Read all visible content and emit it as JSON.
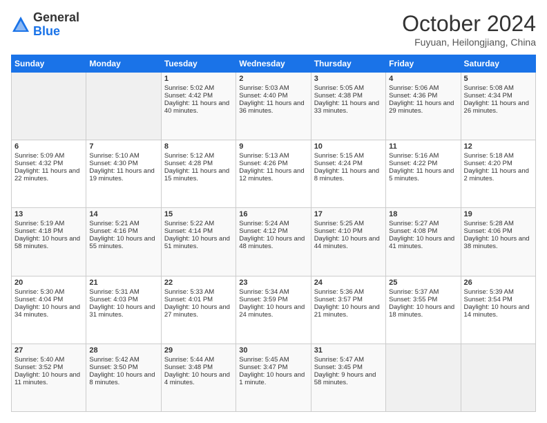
{
  "logo": {
    "general": "General",
    "blue": "Blue"
  },
  "header": {
    "title": "October 2024",
    "subtitle": "Fuyuan, Heilongjiang, China"
  },
  "weekdays": [
    "Sunday",
    "Monday",
    "Tuesday",
    "Wednesday",
    "Thursday",
    "Friday",
    "Saturday"
  ],
  "weeks": [
    [
      {
        "day": "",
        "content": ""
      },
      {
        "day": "",
        "content": ""
      },
      {
        "day": "1",
        "content": "Sunrise: 5:02 AM\nSunset: 4:42 PM\nDaylight: 11 hours and 40 minutes."
      },
      {
        "day": "2",
        "content": "Sunrise: 5:03 AM\nSunset: 4:40 PM\nDaylight: 11 hours and 36 minutes."
      },
      {
        "day": "3",
        "content": "Sunrise: 5:05 AM\nSunset: 4:38 PM\nDaylight: 11 hours and 33 minutes."
      },
      {
        "day": "4",
        "content": "Sunrise: 5:06 AM\nSunset: 4:36 PM\nDaylight: 11 hours and 29 minutes."
      },
      {
        "day": "5",
        "content": "Sunrise: 5:08 AM\nSunset: 4:34 PM\nDaylight: 11 hours and 26 minutes."
      }
    ],
    [
      {
        "day": "6",
        "content": "Sunrise: 5:09 AM\nSunset: 4:32 PM\nDaylight: 11 hours and 22 minutes."
      },
      {
        "day": "7",
        "content": "Sunrise: 5:10 AM\nSunset: 4:30 PM\nDaylight: 11 hours and 19 minutes."
      },
      {
        "day": "8",
        "content": "Sunrise: 5:12 AM\nSunset: 4:28 PM\nDaylight: 11 hours and 15 minutes."
      },
      {
        "day": "9",
        "content": "Sunrise: 5:13 AM\nSunset: 4:26 PM\nDaylight: 11 hours and 12 minutes."
      },
      {
        "day": "10",
        "content": "Sunrise: 5:15 AM\nSunset: 4:24 PM\nDaylight: 11 hours and 8 minutes."
      },
      {
        "day": "11",
        "content": "Sunrise: 5:16 AM\nSunset: 4:22 PM\nDaylight: 11 hours and 5 minutes."
      },
      {
        "day": "12",
        "content": "Sunrise: 5:18 AM\nSunset: 4:20 PM\nDaylight: 11 hours and 2 minutes."
      }
    ],
    [
      {
        "day": "13",
        "content": "Sunrise: 5:19 AM\nSunset: 4:18 PM\nDaylight: 10 hours and 58 minutes."
      },
      {
        "day": "14",
        "content": "Sunrise: 5:21 AM\nSunset: 4:16 PM\nDaylight: 10 hours and 55 minutes."
      },
      {
        "day": "15",
        "content": "Sunrise: 5:22 AM\nSunset: 4:14 PM\nDaylight: 10 hours and 51 minutes."
      },
      {
        "day": "16",
        "content": "Sunrise: 5:24 AM\nSunset: 4:12 PM\nDaylight: 10 hours and 48 minutes."
      },
      {
        "day": "17",
        "content": "Sunrise: 5:25 AM\nSunset: 4:10 PM\nDaylight: 10 hours and 44 minutes."
      },
      {
        "day": "18",
        "content": "Sunrise: 5:27 AM\nSunset: 4:08 PM\nDaylight: 10 hours and 41 minutes."
      },
      {
        "day": "19",
        "content": "Sunrise: 5:28 AM\nSunset: 4:06 PM\nDaylight: 10 hours and 38 minutes."
      }
    ],
    [
      {
        "day": "20",
        "content": "Sunrise: 5:30 AM\nSunset: 4:04 PM\nDaylight: 10 hours and 34 minutes."
      },
      {
        "day": "21",
        "content": "Sunrise: 5:31 AM\nSunset: 4:03 PM\nDaylight: 10 hours and 31 minutes."
      },
      {
        "day": "22",
        "content": "Sunrise: 5:33 AM\nSunset: 4:01 PM\nDaylight: 10 hours and 27 minutes."
      },
      {
        "day": "23",
        "content": "Sunrise: 5:34 AM\nSunset: 3:59 PM\nDaylight: 10 hours and 24 minutes."
      },
      {
        "day": "24",
        "content": "Sunrise: 5:36 AM\nSunset: 3:57 PM\nDaylight: 10 hours and 21 minutes."
      },
      {
        "day": "25",
        "content": "Sunrise: 5:37 AM\nSunset: 3:55 PM\nDaylight: 10 hours and 18 minutes."
      },
      {
        "day": "26",
        "content": "Sunrise: 5:39 AM\nSunset: 3:54 PM\nDaylight: 10 hours and 14 minutes."
      }
    ],
    [
      {
        "day": "27",
        "content": "Sunrise: 5:40 AM\nSunset: 3:52 PM\nDaylight: 10 hours and 11 minutes."
      },
      {
        "day": "28",
        "content": "Sunrise: 5:42 AM\nSunset: 3:50 PM\nDaylight: 10 hours and 8 minutes."
      },
      {
        "day": "29",
        "content": "Sunrise: 5:44 AM\nSunset: 3:48 PM\nDaylight: 10 hours and 4 minutes."
      },
      {
        "day": "30",
        "content": "Sunrise: 5:45 AM\nSunset: 3:47 PM\nDaylight: 10 hours and 1 minute."
      },
      {
        "day": "31",
        "content": "Sunrise: 5:47 AM\nSunset: 3:45 PM\nDaylight: 9 hours and 58 minutes."
      },
      {
        "day": "",
        "content": ""
      },
      {
        "day": "",
        "content": ""
      }
    ]
  ]
}
